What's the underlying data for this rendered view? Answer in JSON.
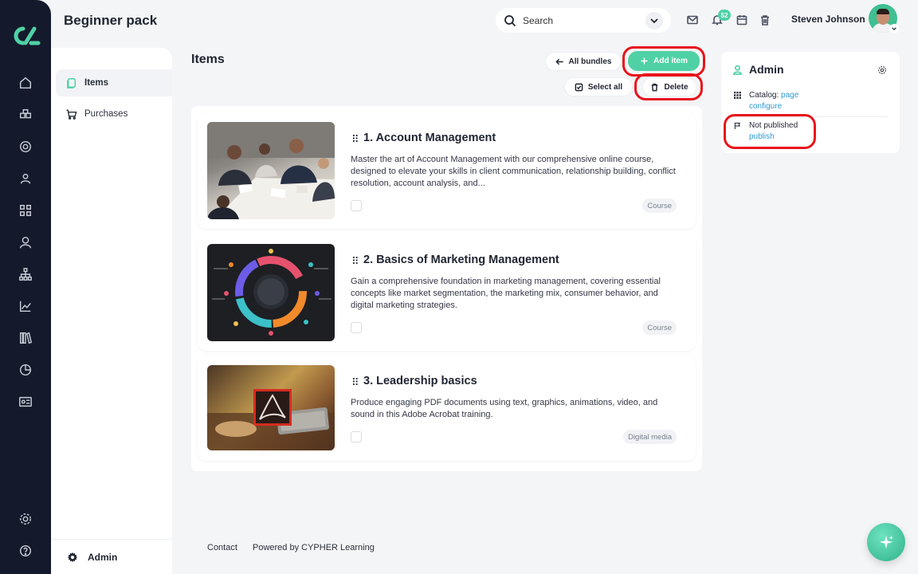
{
  "header": {
    "page_title": "Beginner pack",
    "search_placeholder": "Search",
    "notification_count": "52",
    "user_name": "Steven Johnson"
  },
  "subnav": {
    "items": [
      {
        "label": "Items",
        "icon": "items-icon",
        "active": true
      },
      {
        "label": "Purchases",
        "icon": "cart-icon",
        "active": false
      }
    ],
    "bottom_label": "Admin"
  },
  "main": {
    "title": "Items",
    "all_bundles_label": "All bundles",
    "add_item_label": "Add item",
    "select_all_label": "Select all",
    "delete_label": "Delete",
    "items": [
      {
        "title": "1. Account Management",
        "description": "Master the art of Account Management with our comprehensive online course, designed to elevate your skills in client communication, relationship building, conflict resolution, account analysis, and...",
        "tag": "Course"
      },
      {
        "title": "2. Basics of Marketing Management",
        "description": "Gain a comprehensive foundation in marketing management, covering essential concepts like market segmentation, the marketing mix, consumer behavior, and digital marketing strategies.",
        "tag": "Course"
      },
      {
        "title": "3. Leadership basics",
        "description": "Produce engaging PDF documents using text, graphics, animations, video, and sound in this Adobe Acrobat training.",
        "tag": "Digital media"
      }
    ]
  },
  "admin_panel": {
    "title": "Admin",
    "catalog_label": "Catalog:",
    "catalog_link": "page",
    "configure_link": "configure",
    "status": "Not published",
    "publish_link": "publish"
  },
  "footer": {
    "contact": "Contact",
    "powered": "Powered by CYPHER Learning"
  },
  "colors": {
    "accent": "#4fd1a5",
    "rail": "#141a2b",
    "highlight_ring": "#e8141b",
    "link": "#2f9bd3"
  }
}
